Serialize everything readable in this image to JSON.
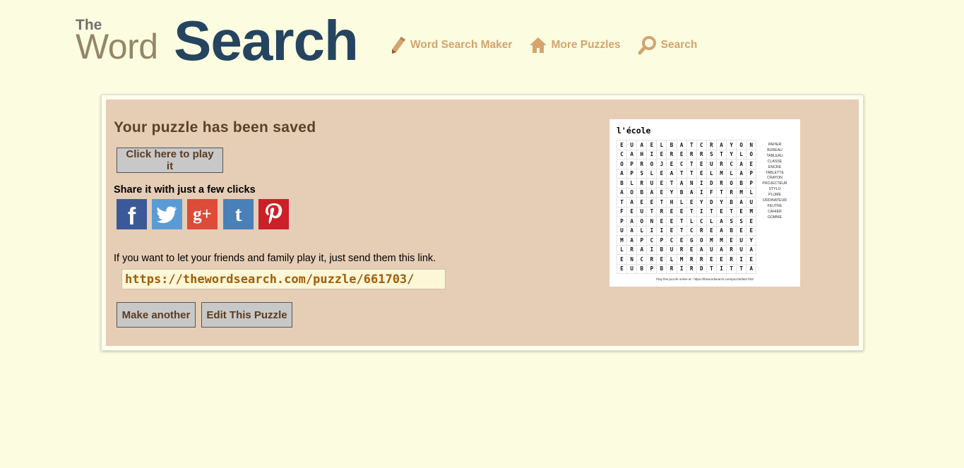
{
  "header": {
    "logo_the": "The",
    "logo_word": "Word",
    "logo_search": "Search",
    "nav": [
      {
        "label": "Word Search Maker",
        "icon": "pencil-icon"
      },
      {
        "label": "More Puzzles",
        "icon": "home-icon"
      },
      {
        "label": "Search",
        "icon": "magnifier-icon"
      }
    ]
  },
  "main": {
    "title": "Your puzzle has been saved",
    "play_button": "Click here to play it",
    "share_label": "Share it with just a few clicks",
    "social": [
      {
        "name": "facebook",
        "glyph": "f"
      },
      {
        "name": "twitter",
        "glyph": ""
      },
      {
        "name": "google-plus",
        "glyph": "g+"
      },
      {
        "name": "tumblr",
        "glyph": "t"
      },
      {
        "name": "pinterest",
        "glyph": ""
      }
    ],
    "link_text": "If you want to let your friends and family play it, just send them this link.",
    "link_url": "https://thewordsearch.com/puzzle/661703/",
    "make_another_button": "Make another",
    "edit_button": "Edit This Puzzle"
  },
  "preview": {
    "title": "l'école",
    "grid": [
      "EUAELBATCRAYON",
      "CAHIERERRSTYLO",
      "OPROJECTEURCAE",
      "APSLEATTELMLAP",
      "BLRUETANIDROBP",
      "AOBAEYBAIFTRML",
      "TAEETHLEYDYBAU",
      "FEUTREETITETEM",
      "PAONEETLCLASSE",
      "UALIIETCREABEE",
      "MAPCPCEGOMMEUY",
      "LRAIBUREAUARUA",
      "ENCRELMRREERIE",
      "EUBPBRIRDTITTA"
    ],
    "words": [
      "PAPIER",
      "BUREAU",
      "TABLEAU",
      "CLASSE",
      "ENCRE",
      "TABLETTE",
      "CRAYON",
      "PROJECTEUR",
      "STYLO",
      "PLUME",
      "ORDINATEUR",
      "FEUTRE",
      "CAHIER",
      "GOMME"
    ],
    "footer": "Play this puzzle online at : https://thewordsearch.com/puzzle/661703/"
  },
  "colors": {
    "background": "#fcfde0",
    "panel": "#e6cdb5",
    "nav_link": "#d4a36e",
    "logo_dark": "#25445f",
    "logo_light": "#948667",
    "link_url": "#a15d05"
  }
}
